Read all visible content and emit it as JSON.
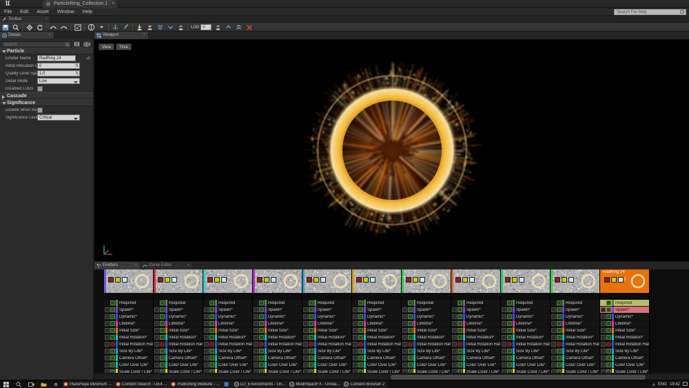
{
  "window": {
    "app_logo": "unreal-engine-logo",
    "document_tab": "ParticleRing_Collection.1",
    "tab_close": "×"
  },
  "menubar": {
    "items": [
      "File",
      "Edit",
      "Asset",
      "Window",
      "Help"
    ],
    "help_search_placeholder": "Search For Help"
  },
  "toolbar_tab": {
    "label": "Toolbar",
    "icon": "wrench-icon",
    "close": "×"
  },
  "toolbar": {
    "buttons": [
      {
        "name": "save-button",
        "icon": "floppy-disk-icon"
      },
      {
        "name": "find-in-content-browser-button",
        "icon": "magnifier-icon"
      },
      {
        "name": "restart-simulation-button",
        "icon": "gear-icon"
      },
      {
        "name": "restart-level-button",
        "icon": "refresh-circle-icon"
      },
      {
        "name": "undo-button",
        "icon": "undo-arrow-icon"
      },
      {
        "name": "redo-button",
        "icon": "redo-arrow-icon"
      },
      {
        "name": "thumbnail-button",
        "icon": "thumbnail-icon"
      },
      {
        "name": "bounds-button",
        "icon": "bounds-circle-icon"
      },
      {
        "name": "bounds-dropdown",
        "icon": "chevron-down-icon"
      },
      {
        "name": "origin-axis-button",
        "icon": "axis-icon"
      },
      {
        "name": "background-color-button",
        "icon": "paint-brush-icon"
      },
      {
        "name": "regenerate-lowest-lod-button",
        "icon": "lod-down-icon"
      },
      {
        "name": "lod-add-button",
        "icon": "lod-add-icon"
      },
      {
        "name": "lod-lower-button",
        "icon": "lod-double-down-icon"
      },
      {
        "name": "lod-down-button",
        "icon": "lod-single-down-icon"
      },
      {
        "name": "lod-higher-button",
        "icon": "lod-up-icon"
      }
    ],
    "lod_label": "LOD",
    "lod_value": "0",
    "lod_spinner": "↕",
    "right_buttons": [
      {
        "name": "lod-jump-highest-button",
        "icon": "double-chevron-up-icon"
      },
      {
        "name": "lod-jump-up-button",
        "icon": "chevron-up-icon"
      },
      {
        "name": "lod-jump-top-button",
        "icon": "double-chevron-top-icon"
      },
      {
        "name": "delete-lod-button",
        "icon": "red-x-icon"
      }
    ]
  },
  "details": {
    "tab_label": "Details",
    "tab_icon": "details-icon",
    "search_placeholder": "Search",
    "search_icon": "search-icon",
    "column-button": "columns-icon",
    "view_options_icon": "eye-icon",
    "sections": [
      {
        "name": "Particle",
        "expanded": true,
        "rows": [
          {
            "label": "Emitter Name",
            "type": "text",
            "value": "RadRing 24",
            "reset": true
          },
          {
            "label": "Initial Allocation Count",
            "type": "number",
            "value": "0"
          },
          {
            "label": "Quality Level Spawn Rate Scale",
            "type": "number",
            "value": "1.0"
          },
          {
            "label": "Detail Mode",
            "type": "combo",
            "value": "Low"
          },
          {
            "label": "Disabled LODs",
            "type": "checkbox",
            "value": ""
          }
        ]
      },
      {
        "name": "Cascade",
        "expanded": false,
        "rows": []
      },
      {
        "name": "Significance",
        "expanded": true,
        "rows": [
          {
            "label": "Disable when Insignificant",
            "type": "checkbox",
            "value": ""
          },
          {
            "label": "Significance Level",
            "type": "combo",
            "value": "Critical"
          }
        ]
      }
    ]
  },
  "viewport": {
    "tab_label": "Viewport",
    "tab_icon": "viewport-icon",
    "view_button": "View",
    "time_button": "Time",
    "gizmo": "axis-gizmo",
    "particle_description": "radial-ring-burst"
  },
  "emitters": {
    "tabs": [
      {
        "label": "Emitters",
        "icon": "emitters-icon",
        "active": true
      },
      {
        "label": "Curve Editor",
        "icon": "curve-icon",
        "active": false
      }
    ],
    "module_colors": {
      "required": "#4f8a3c",
      "spawn": "#8a3fd0",
      "dynamic": "#2a5ad0",
      "lifetime": "#d040b8",
      "initial_size": "#e07820",
      "initial_rotation": "#20c0b0",
      "initial_rotation_rate": "#2a5ad0",
      "size_by_life": "#2a9ad0",
      "camera_offset": "#20c080",
      "color_over_life": "#20b0c0",
      "scale_color_life": "#e0d020"
    },
    "modules": [
      {
        "name": "Required",
        "color_key": "required",
        "has_left_cb": false,
        "enabled": true
      },
      {
        "name": "Spawn*",
        "color_key": "spawn",
        "has_left_cb": true,
        "enabled": true
      },
      {
        "name": "Dynamic*",
        "color_key": "dynamic",
        "has_left_cb": true,
        "enabled": true
      },
      {
        "name": "Lifetime*",
        "color_key": "lifetime",
        "has_left_cb": true,
        "enabled": true
      },
      {
        "name": "Initial Size*",
        "color_key": "initial_size",
        "has_left_cb": true,
        "enabled": true
      },
      {
        "name": "Initial Rotation*",
        "color_key": "initial_rotation",
        "has_left_cb": true,
        "enabled": true
      },
      {
        "name": "Initial Rotation Rate*",
        "color_key": "initial_rotation_rate",
        "has_left_cb": true,
        "enabled": false
      },
      {
        "name": "Size By Life*",
        "color_key": "size_by_life",
        "has_left_cb": true,
        "enabled": true
      },
      {
        "name": "Camera Offset*",
        "color_key": "camera_offset",
        "has_left_cb": true,
        "enabled": true
      },
      {
        "name": "Color Over Life*",
        "color_key": "color_over_life",
        "has_left_cb": true,
        "enabled": true
      },
      {
        "name": "Scale Color / Life*",
        "color_key": "scale_color_life",
        "has_left_cb": true,
        "enabled": true
      }
    ],
    "columns": [
      {
        "name": "",
        "accent": "#6a5adf",
        "selected": false,
        "count": "0"
      },
      {
        "name": "",
        "accent": "#d02a3a",
        "selected": false,
        "count": "0"
      },
      {
        "name": "",
        "accent": "#2ad0d0",
        "selected": false,
        "count": "0"
      },
      {
        "name": "",
        "accent": "#b02ad0",
        "selected": false,
        "count": "0"
      },
      {
        "name": "",
        "accent": "#2a9ad0",
        "selected": false,
        "count": "0"
      },
      {
        "name": "",
        "accent": "#d0a02a",
        "selected": false,
        "count": "0"
      },
      {
        "name": "",
        "accent": "#2ad04a",
        "selected": false,
        "count": "0"
      },
      {
        "name": "",
        "accent": "#d0602a",
        "selected": false,
        "count": "0"
      },
      {
        "name": "",
        "accent": "#2ad06a",
        "selected": false,
        "count": "0"
      },
      {
        "name": "",
        "accent": "#30d040",
        "selected": false,
        "count": "0"
      },
      {
        "name": "RadRing 24",
        "accent": "#e8720c",
        "selected": true,
        "count": "3"
      }
    ],
    "selected_emitter": "RadRing 24",
    "selected_module": "Spawn*"
  },
  "taskbar": {
    "system_icons": [
      "start-icon",
      "search-icon",
      "task-view-icon",
      "folder-icon",
      "settings-icon"
    ],
    "apps": [
      {
        "label": "PlaniPlaye Minimum ...",
        "icon": "chrome-icon"
      },
      {
        "label": "Content Search - UE4 ...",
        "icon": "chrome-icon"
      },
      {
        "label": "Publishing Website - ...",
        "icon": "chrome-icon"
      },
      {
        "label": "",
        "icon": "blue-app-icon"
      },
      {
        "label": "LU_Environments - Un...",
        "icon": "unreal-icon"
      },
      {
        "label": "ModImpactFX - Unrea...",
        "icon": "unreal-icon"
      },
      {
        "label": "Content Browser 2",
        "icon": "unreal-icon"
      }
    ],
    "tray": {
      "chevron": "∧",
      "language": "ENG",
      "time": "19:42",
      "notification_icon": "notification-icon"
    }
  }
}
